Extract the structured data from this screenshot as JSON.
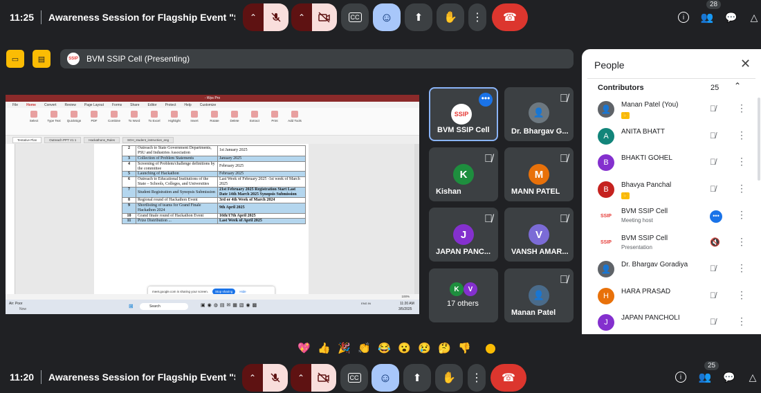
{
  "top": {
    "time": "11:25",
    "title": "Awareness Session for Flagship Event \"Smart Guj...",
    "people_count": "28"
  },
  "bottom": {
    "time": "11:20",
    "title": "Awareness Session for Flagship Event \"Smart Guj...",
    "people_count": "25"
  },
  "presenter": {
    "label": "BVM SSIP Cell (Presenting)",
    "logo": "SSIP"
  },
  "wps": {
    "title": "- Wps Pro",
    "menu": [
      "File",
      "Home",
      "Convert",
      "Review",
      "Page Layout",
      "Forms",
      "Share",
      "Editor",
      "Protect",
      "Help",
      "Customize"
    ],
    "tools": [
      "Select",
      "Type Text",
      "QuickSign",
      "PDF",
      "Combine",
      "To Word",
      "To Excel",
      "Highlight",
      "Insert",
      "Rotate",
      "Delete",
      "Extract",
      "Print",
      "Add Tools"
    ],
    "groups": [
      "Tools",
      "Create",
      "Convert",
      "Review",
      "Page Layout",
      "Document",
      "Favorite Tools"
    ],
    "side": [
      "Hand",
      "Edit",
      "Zoom"
    ],
    "tabs": [
      "Tentative Plan",
      "Outreach PPT V1 1",
      "Hackathons_Rules",
      "SGH_student_instruction_eng"
    ],
    "rows": [
      {
        "no": "2",
        "activity": "Outreach to State Government Departments, PSU and Industries Association",
        "date": "1st January 2025",
        "hl": false
      },
      {
        "no": "3",
        "activity": "Collection of Problem Statements",
        "date": "January 2025",
        "hl": true
      },
      {
        "no": "4",
        "activity": "Screening of Problem/challenge definitions by the committee",
        "date": "February 2025",
        "hl": false
      },
      {
        "no": "5",
        "activity": "Launching of Hackathon",
        "date": "February 2025",
        "hl": true
      },
      {
        "no": "6",
        "activity": "Outreach to Educational Institutions of the State – Schools, Colleges, and Universities",
        "date": "Last Week of February 2025 -1st week of March 2025",
        "hl": false
      },
      {
        "no": "7",
        "activity": "Student Registration and Synopsis Submission",
        "date": "21st February 2025 Registration Start Last Date 14th March 2025 Synopsis Submission",
        "hl": true
      },
      {
        "no": "8",
        "activity": "Regional round of Hackathon Event",
        "date": "3rd or 4th Week of March 2024",
        "hl": false
      },
      {
        "no": "9",
        "activity": "Shortlisting of teams for Grand Finale Hackathon 2024",
        "date": "9th April 2025",
        "hl": true
      },
      {
        "no": "10",
        "activity": "Grand finale round of Hackathon Event",
        "date": "16th/17th April 2025",
        "hl": false
      },
      {
        "no": "11",
        "activity": "Prize Distribution ... ",
        "date": "Last Week of April 2025",
        "hl": true
      }
    ],
    "share_msg": "meet.google.com is sharing your screen.",
    "stop": "Stop sharing",
    "hide": "Hide",
    "zoom": "100%",
    "taskbar": {
      "weather": "Air: Poor",
      "weather_sub": "Now",
      "search": "Search",
      "lang": "ENG IN",
      "time": "11:20 AM",
      "date": "3/5/2025"
    }
  },
  "tiles": [
    {
      "name": "BVM SSIP Cell",
      "kind": "logo",
      "logo": "SSIP"
    },
    {
      "name": "Dr. Bhargav G...",
      "kind": "photo"
    },
    {
      "name": "Kishan",
      "letter": "K",
      "color": "#1e8e3e"
    },
    {
      "name": "MANN PATEL",
      "letter": "M",
      "color": "#e8710a"
    },
    {
      "name": "JAPAN PANC...",
      "letter": "J",
      "color": "#8430ce"
    },
    {
      "name": "VANSH AMAR...",
      "letter": "V",
      "color": "#7b6bd6"
    },
    {
      "name": "17 others",
      "kind": "others",
      "l1": "K",
      "l2": "V"
    },
    {
      "name": "Manan Patel",
      "kind": "photo"
    }
  ],
  "panel": {
    "title": "People",
    "section": "Contributors",
    "count": "25",
    "people": [
      {
        "name": "Manan Patel (You)",
        "sub": "",
        "avatar": "",
        "color": "#5f6368",
        "photo": true
      },
      {
        "name": "ANITA BHATT",
        "sub": "",
        "avatar": "A",
        "color": "#12857a"
      },
      {
        "name": "BHAKTI GOHEL",
        "sub": "",
        "avatar": "B",
        "color": "#8430ce"
      },
      {
        "name": "Bhavya Panchal",
        "sub": "",
        "avatar": "B",
        "color": "#c5221f"
      },
      {
        "name": "BVM SSIP Cell",
        "sub": "Meeting host",
        "avatar": "SSIP",
        "color": "#ffffff"
      },
      {
        "name": "BVM SSIP Cell",
        "sub": "Presentation",
        "avatar": "SSIP",
        "color": "#ffffff"
      },
      {
        "name": "Dr. Bhargav Goradiya",
        "sub": "",
        "avatar": "",
        "color": "#5f6368",
        "photo": true
      },
      {
        "name": "HARA PRASAD",
        "sub": "",
        "avatar": "H",
        "color": "#e8710a"
      },
      {
        "name": "JAPAN PANCHOLI",
        "sub": "",
        "avatar": "J",
        "color": "#8430ce"
      }
    ]
  },
  "reactions": [
    "💖",
    "👍",
    "🎉",
    "👏",
    "😂",
    "😮",
    "😢",
    "🤔",
    "👎"
  ]
}
